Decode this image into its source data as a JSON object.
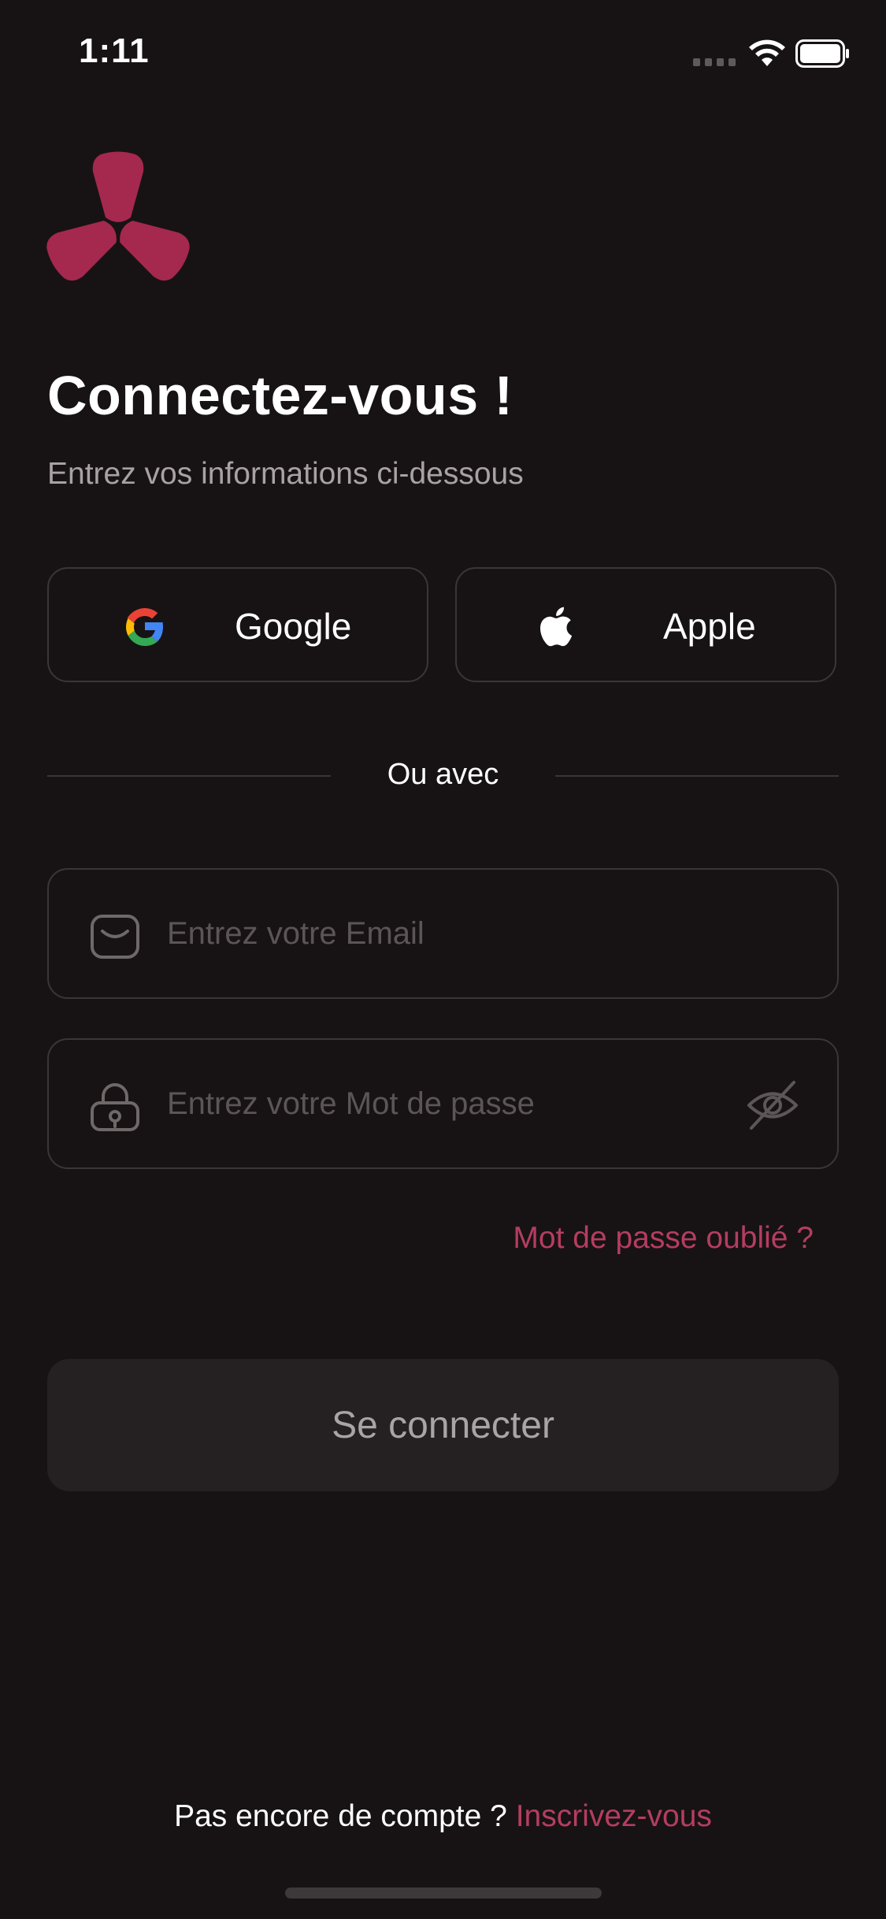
{
  "status_bar": {
    "time": "1:11",
    "icons": [
      "signal-dots-icon",
      "wifi-icon",
      "battery-icon"
    ]
  },
  "brand": {
    "logo": "trefoil-logo",
    "accent_color": "#a5284f"
  },
  "header": {
    "title": "Connectez-vous !",
    "subtitle": "Entrez vos informations ci-dessous"
  },
  "social": {
    "google_label": "Google",
    "apple_label": "Apple"
  },
  "divider": {
    "text": "Ou avec"
  },
  "form": {
    "email": {
      "icon": "mail-icon",
      "value": "",
      "placeholder": "Entrez votre Email"
    },
    "password": {
      "icon": "lock-icon",
      "value": "",
      "placeholder": "Entrez votre Mot de passe",
      "toggle_icon": "eye-off-icon"
    },
    "forgot_label": "Mot de passe oublié ?",
    "submit_label": "Se connecter"
  },
  "footer": {
    "prompt": "Pas encore de compte ?",
    "signup_label": "Inscrivez-vous"
  }
}
